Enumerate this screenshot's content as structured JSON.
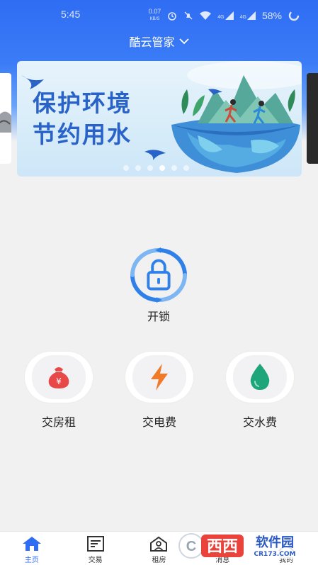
{
  "status_bar": {
    "time": "5:45",
    "net_speed": "0.07",
    "net_unit": "KB/S",
    "signal1": "4G",
    "signal2": "4G",
    "battery": "58%"
  },
  "header": {
    "title": "酷云管家"
  },
  "banner": {
    "line1": "保护环境",
    "line2": "节约用水",
    "dot_count": 6,
    "active_dot": 3
  },
  "unlock": {
    "label": "开锁"
  },
  "actions": [
    {
      "label": "交房租",
      "icon": "money-bag-icon",
      "color": "#e84848"
    },
    {
      "label": "交电费",
      "icon": "lightning-icon",
      "color": "#f07a2a"
    },
    {
      "label": "交水费",
      "icon": "water-drop-icon",
      "color": "#1fa57a"
    }
  ],
  "tabbar": {
    "items": [
      {
        "label": "主页",
        "icon": "home-icon",
        "active": true
      },
      {
        "label": "交易",
        "icon": "document-icon",
        "active": false
      },
      {
        "label": "租房",
        "icon": "house-person-icon",
        "active": false
      },
      {
        "label": "消息",
        "icon": "message-icon",
        "active": false
      },
      {
        "label": "我的",
        "icon": "user-icon",
        "active": false
      }
    ]
  },
  "watermark": {
    "brand": "西西",
    "sub": "软件园",
    "url": "CR173.COM"
  },
  "colors": {
    "primary": "#2f6df4",
    "banner_text": "#2a63c8"
  }
}
